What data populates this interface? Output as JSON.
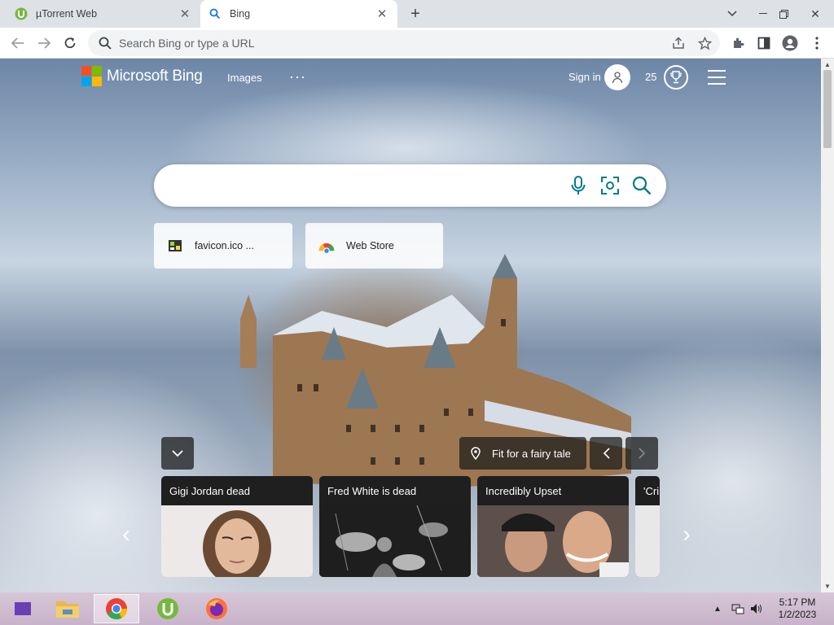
{
  "browser": {
    "tabs": [
      {
        "title": "µTorrent Web",
        "active": false
      },
      {
        "title": "Bing",
        "active": true
      }
    ],
    "address": {
      "value": "",
      "placeholder": "Search Bing or type a URL"
    }
  },
  "bing": {
    "logo_text": "Microsoft Bing",
    "nav_images": "Images",
    "more": "···",
    "sign_in": "Sign in",
    "points": "25",
    "search_placeholder": "",
    "quick_links": [
      {
        "label": "favicon.ico ..."
      },
      {
        "label": "Web Store"
      }
    ],
    "image_caption": "Fit for a fairy tale",
    "news": [
      {
        "title": "Gigi Jordan dead"
      },
      {
        "title": "Fred White is dead"
      },
      {
        "title": "Incredibly Upset"
      },
      {
        "title": "'Cri"
      }
    ]
  },
  "taskbar": {
    "time": "5:17 PM",
    "date": "1/2/2023"
  },
  "colors": {
    "bing_icon": "#007a8a",
    "ms_red": "#f25022",
    "ms_green": "#7fba00",
    "ms_blue": "#00a4ef",
    "ms_yellow": "#ffb900",
    "taskbar": "#c8b3ca"
  }
}
